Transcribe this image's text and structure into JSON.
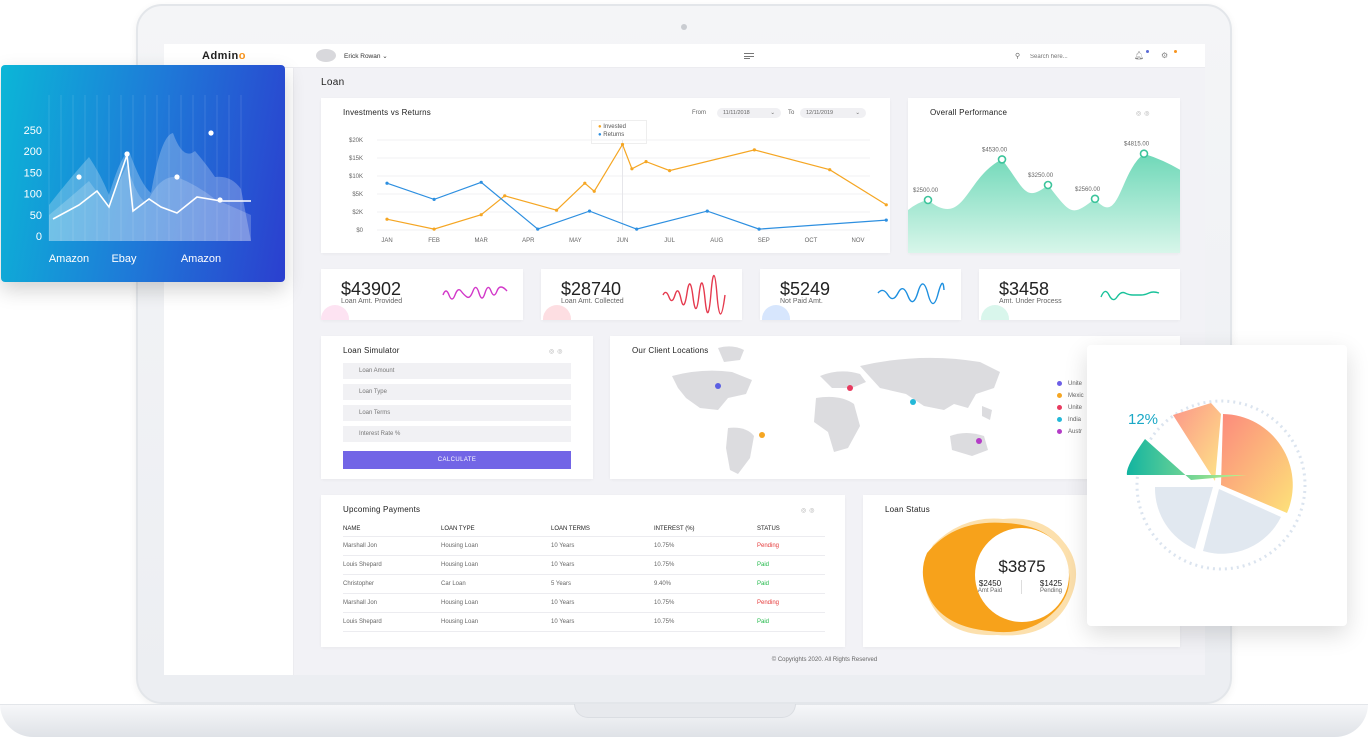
{
  "topbar": {
    "logo_main": "Admin",
    "logo_accent": "o",
    "user_name": "Erick Rowan",
    "user_chevron": "⌄",
    "search_placeholder": "Search here..."
  },
  "page": {
    "title": "Loan",
    "footer": "© Copyrights 2020. All Rights Reserved"
  },
  "investments": {
    "title": "Investments vs Returns",
    "from_label": "From",
    "from_date": "11/11/2018",
    "to_label": "To",
    "to_date": "12/11/2019",
    "legend_invested": "Invested",
    "legend_returns": "Returns"
  },
  "performance": {
    "title": "Overall Performance",
    "labels": [
      "$2500.00",
      "$4530.00",
      "$3250.00",
      "$2560.00",
      "$4815.00"
    ]
  },
  "stats": [
    {
      "value": "$43902",
      "label": "Loan Amt. Provided"
    },
    {
      "value": "$28740",
      "label": "Loan Amt. Collected"
    },
    {
      "value": "$5249",
      "label": "Not Paid Amt."
    },
    {
      "value": "$3458",
      "label": "Amt. Under Process"
    }
  ],
  "simulator": {
    "title": "Loan Simulator",
    "fields": [
      "Loan Amount",
      "Loan Type",
      "Loan Terms",
      "Interest Rate %"
    ],
    "button": "CALCULATE"
  },
  "locations": {
    "title": "Our Client Locations",
    "legend": [
      "Unite",
      "Mexic",
      "Unite",
      "India",
      "Austr"
    ]
  },
  "payments": {
    "title": "Upcoming Payments",
    "columns": [
      "NAME",
      "LOAN TYPE",
      "LOAN TERMS",
      "INTEREST (%)",
      "STATUS"
    ],
    "rows": [
      [
        "Marshall Jon",
        "Housing Loan",
        "10 Years",
        "10.75%",
        "Pending"
      ],
      [
        "Louis Shepard",
        "Housing Loan",
        "10 Years",
        "10.75%",
        "Paid"
      ],
      [
        "Christopher",
        "Car Loan",
        "5 Years",
        "9.40%",
        "Paid"
      ],
      [
        "Marshall Jon",
        "Housing Loan",
        "10 Years",
        "10.75%",
        "Pending"
      ],
      [
        "Louis Shepard",
        "Housing Loan",
        "10 Years",
        "10.75%",
        "Paid"
      ]
    ]
  },
  "loan_status": {
    "title": "Loan Status",
    "total": "$3875",
    "paid_value": "$2450",
    "paid_label": "Amt Paid",
    "pending_value": "$1425",
    "pending_label": "Pending"
  },
  "pie_card": {
    "percent": "12%"
  },
  "chart_data": [
    {
      "type": "line",
      "title": "Investments vs Returns",
      "categories": [
        "JAN",
        "FEB",
        "MAR",
        "APR",
        "MAY",
        "JUN",
        "JUL",
        "AUG",
        "SEP",
        "OCT",
        "NOV"
      ],
      "ytick_labels": [
        "$0",
        "$2K",
        "$5K",
        "$10K",
        "$15K",
        "$20K"
      ],
      "series": [
        {
          "name": "Invested",
          "color": "#f5a623",
          "points": [
            [
              0,
              1.2
            ],
            [
              1,
              0.1
            ],
            [
              2,
              1.7
            ],
            [
              2.5,
              3.8
            ],
            [
              3.6,
              2.2
            ],
            [
              4.2,
              5.2
            ],
            [
              4.4,
              4.3
            ],
            [
              5,
              9.5
            ],
            [
              5.2,
              6.8
            ],
            [
              5.5,
              7.6
            ],
            [
              6,
              6.6
            ],
            [
              7.8,
              8.9
            ],
            [
              9.4,
              6.7
            ],
            [
              10.6,
              2.8
            ]
          ]
        },
        {
          "name": "Returns",
          "color": "#2d8fe0",
          "points": [
            [
              0,
              5.2
            ],
            [
              1,
              3.4
            ],
            [
              2,
              5.3
            ],
            [
              3.2,
              0.1
            ],
            [
              4.3,
              2.1
            ],
            [
              5.3,
              0.1
            ],
            [
              6.8,
              2.1
            ],
            [
              7.9,
              0.1
            ],
            [
              10.6,
              1.1
            ]
          ]
        }
      ],
      "ylim": [
        0,
        10
      ],
      "grid": true
    },
    {
      "type": "area",
      "title": "Overall Performance",
      "values": [
        2500,
        4530,
        3250,
        2560,
        4815
      ],
      "point_labels": [
        "$2500.00",
        "$4530.00",
        "$3250.00",
        "$2560.00",
        "$4815.00"
      ]
    },
    {
      "type": "area",
      "title": "",
      "categories": [
        "Amazon",
        "Ebay",
        "Amazon"
      ],
      "ytick_labels": [
        "0",
        "50",
        "100",
        "150",
        "200",
        "250"
      ],
      "ylim": [
        0,
        250
      ]
    },
    {
      "type": "pie",
      "title": "",
      "values": [
        12,
        48,
        20,
        20
      ],
      "labels": [
        "12%"
      ]
    }
  ]
}
